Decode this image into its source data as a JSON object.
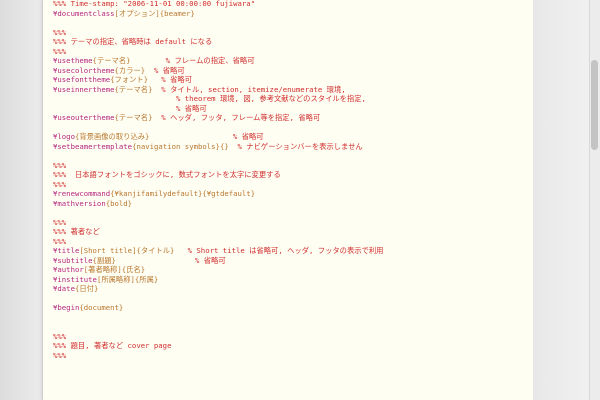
{
  "editor": {
    "lines": [
      [
        {
          "t": "%%% Time-stamp: \"2006-11-01 00:00:00 fujiwara\"",
          "c": "cmt"
        }
      ],
      [
        {
          "t": "¥documentclass",
          "c": "cmd"
        },
        {
          "t": "[オプション]{beamer}",
          "c": "arg"
        }
      ],
      [],
      [
        {
          "t": "%%%",
          "c": "cmt"
        }
      ],
      [
        {
          "t": "%%% テーマの指定、省略時は default になる",
          "c": "cmt"
        }
      ],
      [
        {
          "t": "%%%",
          "c": "cmt"
        }
      ],
      [
        {
          "t": "¥usetheme",
          "c": "cmd"
        },
        {
          "t": "{テーマ名}",
          "c": "arg"
        },
        {
          "t": "        % フレームの指定、省略可",
          "c": "cmt"
        }
      ],
      [
        {
          "t": "¥usecolortheme",
          "c": "cmd"
        },
        {
          "t": "{カラー}",
          "c": "arg"
        },
        {
          "t": "  % 省略可",
          "c": "cmt"
        }
      ],
      [
        {
          "t": "¥usefonttheme",
          "c": "cmd"
        },
        {
          "t": "{フォント}",
          "c": "arg"
        },
        {
          "t": "   % 省略可",
          "c": "cmt"
        }
      ],
      [
        {
          "t": "¥useinnertheme",
          "c": "cmd"
        },
        {
          "t": "{テーマ名}",
          "c": "arg"
        },
        {
          "t": "  % タイトル, section, itemize/enumerate 環境,",
          "c": "cmt"
        }
      ],
      [
        {
          "t": "                            % theorem 環境, 図, 参考文献などのスタイルを指定,",
          "c": "cmt"
        }
      ],
      [
        {
          "t": "                            % 省略可",
          "c": "cmt"
        }
      ],
      [
        {
          "t": "¥useoutertheme",
          "c": "cmd"
        },
        {
          "t": "{テーマ名}",
          "c": "arg"
        },
        {
          "t": "  % ヘッダ, フッタ, フレーム等を指定, 省略可",
          "c": "cmt"
        }
      ],
      [],
      [
        {
          "t": "¥logo",
          "c": "cmd"
        },
        {
          "t": "{背景画像の取り込み}",
          "c": "arg"
        },
        {
          "t": "                   % 省略可",
          "c": "cmt"
        }
      ],
      [
        {
          "t": "¥setbeamertemplate",
          "c": "cmd"
        },
        {
          "t": "{navigation symbols}{}",
          "c": "arg"
        },
        {
          "t": "  % ナビゲーションバーを表示しません",
          "c": "cmt"
        }
      ],
      [],
      [
        {
          "t": "%%%",
          "c": "cmt"
        }
      ],
      [
        {
          "t": "%%%  日本語フォントをゴシックに, 数式フォントを太字に変更する",
          "c": "cmt"
        }
      ],
      [
        {
          "t": "%%%",
          "c": "cmt"
        }
      ],
      [
        {
          "t": "¥renewcommand",
          "c": "cmd"
        },
        {
          "t": "{¥kanjifamilydefault}{¥gtdefault}",
          "c": "arg"
        }
      ],
      [
        {
          "t": "¥mathversion",
          "c": "cmd"
        },
        {
          "t": "{bold}",
          "c": "arg"
        }
      ],
      [],
      [
        {
          "t": "%%%",
          "c": "cmt"
        }
      ],
      [
        {
          "t": "%%% 著者など",
          "c": "cmt"
        }
      ],
      [
        {
          "t": "%%%",
          "c": "cmt"
        }
      ],
      [
        {
          "t": "¥title",
          "c": "cmd"
        },
        {
          "t": "[Short title]{タイトル}",
          "c": "arg"
        },
        {
          "t": "   % Short title は省略可, ヘッダ, フッタの表示で利用",
          "c": "cmt"
        }
      ],
      [
        {
          "t": "¥subtitle",
          "c": "cmd"
        },
        {
          "t": "{副題}",
          "c": "arg"
        },
        {
          "t": "                  % 省略可",
          "c": "cmt"
        }
      ],
      [
        {
          "t": "¥author",
          "c": "cmd"
        },
        {
          "t": "[著者略称]{氏名}",
          "c": "arg"
        }
      ],
      [
        {
          "t": "¥institute",
          "c": "cmd"
        },
        {
          "t": "[所属略称]{所属}",
          "c": "arg"
        }
      ],
      [
        {
          "t": "¥date",
          "c": "cmd"
        },
        {
          "t": "{日付}",
          "c": "arg"
        }
      ],
      [],
      [
        {
          "t": "¥begin",
          "c": "cmd"
        },
        {
          "t": "{document}",
          "c": "arg"
        }
      ],
      [],
      [],
      [
        {
          "t": "%%%",
          "c": "cmt"
        }
      ],
      [
        {
          "t": "%%% 題目, 著者など cover page",
          "c": "cmt"
        }
      ],
      [
        {
          "t": "%%%",
          "c": "cmt"
        }
      ]
    ]
  },
  "colors": {
    "command": "#b4257e",
    "argument": "#b8762e",
    "comment": "#d02d2d",
    "paper": "#fffef3"
  }
}
